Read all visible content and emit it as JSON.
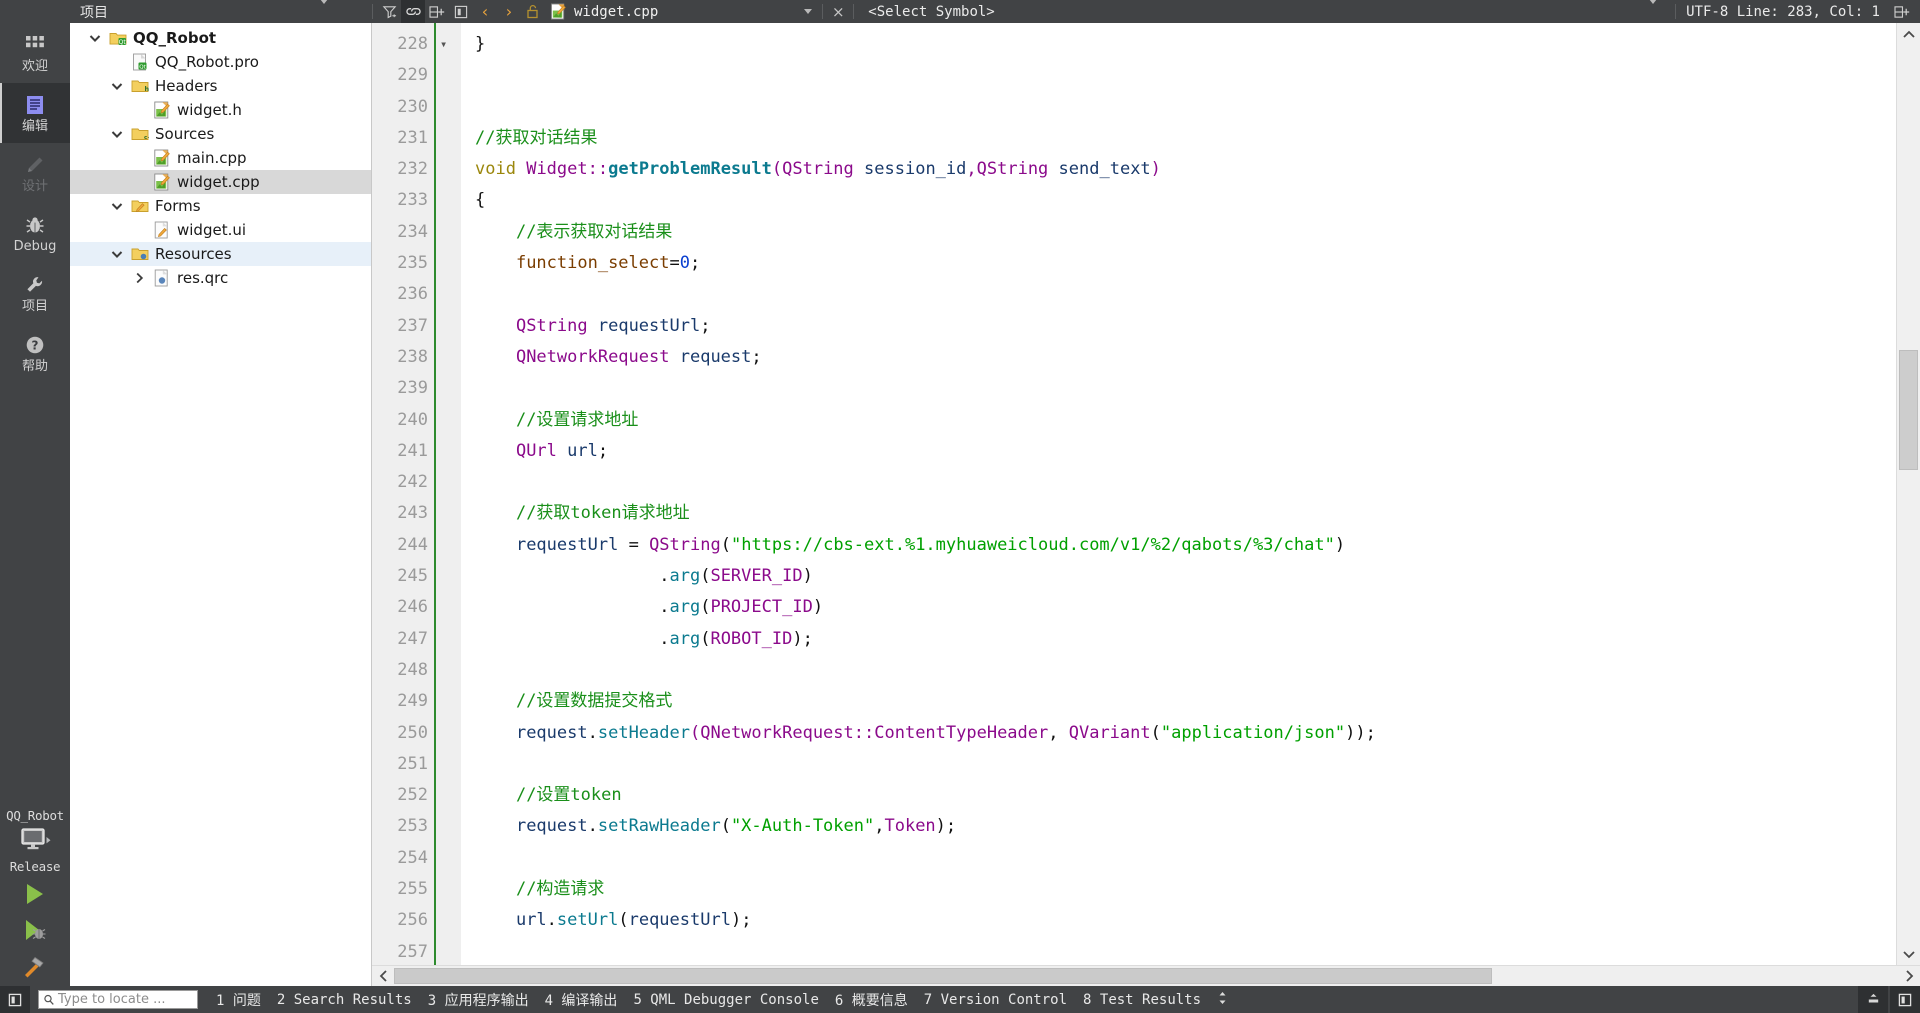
{
  "topbar": {
    "project_selector_label": "项目",
    "icons": [
      "filter-icon",
      "link-icon",
      "split-add-icon",
      "sidebar-icon"
    ],
    "nav_back": "‹",
    "nav_forward": "›",
    "lock_icon": "unlock-icon",
    "file_icon": "cpp-file-icon",
    "filename": "widget.cpp",
    "close_label": "×",
    "symbol_selector": "<Select Symbol>",
    "encoding_status": "UTF-8 Line: 283, Col: 1",
    "right_icon": "split-add-icon"
  },
  "rail": {
    "modes": [
      {
        "label": "欢迎",
        "icon": "grid-icon",
        "state": "normal"
      },
      {
        "label": "编辑",
        "icon": "document-lines-icon",
        "state": "selected"
      },
      {
        "label": "设计",
        "icon": "pencil-icon",
        "state": "disabled"
      },
      {
        "label": "Debug",
        "icon": "bug-icon",
        "state": "normal"
      },
      {
        "label": "项目",
        "icon": "wrench-icon",
        "state": "normal"
      },
      {
        "label": "帮助",
        "icon": "question-circle-icon",
        "state": "normal"
      }
    ],
    "kit": {
      "project_name": "QQ_Robot",
      "monitor_icon": "monitor-icon",
      "build_config": "Release",
      "run_icon": "run-play-icon",
      "debug_icon": "run-debug-icon",
      "build_icon": "hammer-icon"
    }
  },
  "tree": {
    "items": [
      {
        "label": "QQ_Robot",
        "indent": 0,
        "arrow": "down",
        "icon": "qt-project-icon",
        "bold": true,
        "state": "normal"
      },
      {
        "label": "QQ_Robot.pro",
        "indent": 1,
        "arrow": "none",
        "icon": "pro-file-icon",
        "bold": false,
        "state": "normal"
      },
      {
        "label": "Headers",
        "indent": 1,
        "arrow": "down",
        "icon": "folder-h-icon",
        "bold": false,
        "state": "normal"
      },
      {
        "label": "widget.h",
        "indent": 2,
        "arrow": "none",
        "icon": "h-file-icon",
        "bold": false,
        "state": "normal"
      },
      {
        "label": "Sources",
        "indent": 1,
        "arrow": "down",
        "icon": "folder-cpp-icon",
        "bold": false,
        "state": "normal"
      },
      {
        "label": "main.cpp",
        "indent": 2,
        "arrow": "none",
        "icon": "cpp-file-icon",
        "bold": false,
        "state": "normal"
      },
      {
        "label": "widget.cpp",
        "indent": 2,
        "arrow": "none",
        "icon": "cpp-file-icon",
        "bold": false,
        "state": "selected"
      },
      {
        "label": "Forms",
        "indent": 1,
        "arrow": "down",
        "icon": "folder-ui-icon",
        "bold": false,
        "state": "normal"
      },
      {
        "label": "widget.ui",
        "indent": 2,
        "arrow": "none",
        "icon": "ui-file-icon",
        "bold": false,
        "state": "normal"
      },
      {
        "label": "Resources",
        "indent": 1,
        "arrow": "down",
        "icon": "folder-qrc-icon",
        "bold": false,
        "state": "highlight"
      },
      {
        "label": "res.qrc",
        "indent": 2,
        "arrow": "right",
        "icon": "qrc-file-icon",
        "bold": false,
        "state": "normal"
      }
    ]
  },
  "editor": {
    "first_line": 228,
    "lines": [
      {
        "n": 228,
        "fold": "",
        "html": "<span class=\"blk\">}</span>"
      },
      {
        "n": 229,
        "fold": "",
        "html": ""
      },
      {
        "n": 230,
        "fold": "",
        "html": ""
      },
      {
        "n": 231,
        "fold": "",
        "html": "<span class=\"cmt\">//获取对话结果</span>"
      },
      {
        "n": 232,
        "fold": "▾",
        "html": "<span class=\"kw\">void</span> <span class=\"cls\">Widget</span><span class=\"cls\">::</span><span class=\"fn\">getProblemResult</span><span class=\"cls\">(</span><span class=\"cls\">QString</span> <span class=\"pln\">session_id</span><span class=\"cls\">,</span><span class=\"cls\">QString</span> <span class=\"pln\">send_text</span><span class=\"cls\">)</span>"
      },
      {
        "n": 233,
        "fold": "",
        "html": "<span class=\"blk\">{</span>"
      },
      {
        "n": 234,
        "fold": "",
        "html": "    <span class=\"cmt\">//表示获取对话结果</span>"
      },
      {
        "n": 235,
        "fold": "",
        "html": "    <span class=\"var\">function_select</span><span class=\"blk\">=</span><span class=\"num\">0</span><span class=\"blk\">;</span>"
      },
      {
        "n": 236,
        "fold": "",
        "html": ""
      },
      {
        "n": 237,
        "fold": "",
        "html": "    <span class=\"cls\">QString</span> <span class=\"pln\">requestUrl</span><span class=\"blk\">;</span>"
      },
      {
        "n": 238,
        "fold": "",
        "html": "    <span class=\"cls\">QNetworkRequest</span> <span class=\"pln\">request</span><span class=\"blk\">;</span>"
      },
      {
        "n": 239,
        "fold": "",
        "html": ""
      },
      {
        "n": 240,
        "fold": "",
        "html": "    <span class=\"cmt\">//设置请求地址</span>"
      },
      {
        "n": 241,
        "fold": "",
        "html": "    <span class=\"cls\">QUrl</span> <span class=\"pln\">url</span><span class=\"blk\">;</span>"
      },
      {
        "n": 242,
        "fold": "",
        "html": ""
      },
      {
        "n": 243,
        "fold": "",
        "html": "    <span class=\"cmt\">//获取token请求地址</span>"
      },
      {
        "n": 244,
        "fold": "",
        "html": "    <span class=\"pln\">requestUrl</span> <span class=\"blk\">=</span> <span class=\"cls\">QString</span><span class=\"blk\">(</span><span class=\"str\">\"https://cbs-ext.%1.myhuaweicloud.com/v1/%2/qabots/%3/chat\"</span><span class=\"blk\">)</span>"
      },
      {
        "n": 245,
        "fold": "",
        "html": "                  <span class=\"blk\">.</span><span class=\"fn2\">arg</span><span class=\"blk\">(</span><span class=\"cls\">SERVER_ID</span><span class=\"blk\">)</span>"
      },
      {
        "n": 246,
        "fold": "",
        "html": "                  <span class=\"blk\">.</span><span class=\"fn2\">arg</span><span class=\"blk\">(</span><span class=\"cls\">PROJECT_ID</span><span class=\"blk\">)</span>"
      },
      {
        "n": 247,
        "fold": "",
        "html": "                  <span class=\"blk\">.</span><span class=\"fn2\">arg</span><span class=\"blk\">(</span><span class=\"cls\">ROBOT_ID</span><span class=\"blk\">);</span>"
      },
      {
        "n": 248,
        "fold": "",
        "html": ""
      },
      {
        "n": 249,
        "fold": "",
        "html": "    <span class=\"cmt\">//设置数据提交格式</span>"
      },
      {
        "n": 250,
        "fold": "",
        "html": "    <span class=\"pln\">request</span><span class=\"blk\">.</span><span class=\"fn2\">setHeader</span><span class=\"cls\">(</span><span class=\"cls\">QNetworkRequest</span><span class=\"cls\">::</span><span class=\"cls\">ContentTypeHeader</span><span class=\"blk\">, </span><span class=\"cls\">QVariant</span><span class=\"blk\">(</span><span class=\"str\">\"application/json\"</span><span class=\"blk\">));</span>"
      },
      {
        "n": 251,
        "fold": "",
        "html": ""
      },
      {
        "n": 252,
        "fold": "",
        "html": "    <span class=\"cmt\">//设置token</span>"
      },
      {
        "n": 253,
        "fold": "",
        "html": "    <span class=\"pln\">request</span><span class=\"blk\">.</span><span class=\"fn2\">setRawHeader</span><span class=\"blk\">(</span><span class=\"str\">\"X-Auth-Token\"</span><span class=\"blk\">,</span><span class=\"cls\">Token</span><span class=\"blk\">);</span>"
      },
      {
        "n": 254,
        "fold": "",
        "html": ""
      },
      {
        "n": 255,
        "fold": "",
        "html": "    <span class=\"cmt\">//构造请求</span>"
      },
      {
        "n": 256,
        "fold": "",
        "html": "    <span class=\"pln\">url</span><span class=\"blk\">.</span><span class=\"fn2\">setUrl</span><span class=\"blk\">(</span><span class=\"pln\">requestUrl</span><span class=\"blk\">);</span>"
      },
      {
        "n": 257,
        "fold": "",
        "html": ""
      }
    ]
  },
  "statusbar": {
    "toggle_icon": "sidebar-toggle-icon",
    "locate_placeholder": "Type to locate ...",
    "search_icon": "search-icon",
    "panes": [
      "1 问题",
      "2 Search Results",
      "3 应用程序输出",
      "4 编译输出",
      "5 QML Debugger Console",
      "6 概要信息",
      "7 Version Control",
      "8 Test Results"
    ],
    "resize_handle": "updown-arrows-icon",
    "right_buttons": [
      "minimize-pane-icon",
      "toggle-sidebar-icon"
    ]
  },
  "colors": {
    "chrome": "#414345",
    "chrome_dark": "#2e3032",
    "accent_green": "#8ac04a",
    "comment_green": "#1a8f1a",
    "string_green": "#00a000",
    "class_purple": "#8b0a8b",
    "fn_teal": "#0b7a8f",
    "kw_olive": "#9b870c",
    "selection_gray": "#d8d8d8",
    "highlight_blue": "#e7f0f9"
  }
}
